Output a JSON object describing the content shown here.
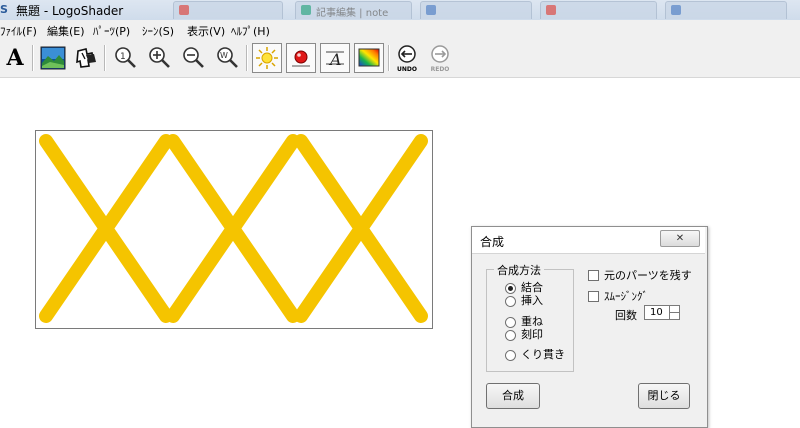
{
  "window": {
    "app_icon_text": "S",
    "title": "無題 - LogoShader",
    "background_tabs": [
      "",
      "記事編集 | note",
      "",
      "",
      ""
    ]
  },
  "menu": [
    "ﾌｧｲﾙ(F)",
    "編集(E)",
    "ﾊﾟｰﾂ(P)",
    "ｼｰﾝ(S)",
    "表示(V)",
    "ﾍﾙﾌﾟ(H)"
  ],
  "toolbar": {
    "text_tool_label": "A",
    "undo_label": "UNDO",
    "redo_label": "REDO",
    "icons": [
      "text-tool-icon",
      "landscape-image-icon",
      "puzzle-parts-icon",
      "zoom-1x-icon",
      "zoom-in-icon",
      "zoom-out-icon",
      "zoom-window-icon",
      "light-source-icon",
      "red-ball-material-icon",
      "edit-shape-icon",
      "rainbow-color-icon",
      "undo-icon",
      "redo-icon"
    ]
  },
  "canvas": {
    "shape_color": "#f5c400",
    "description_shape": "XXX"
  },
  "dialog": {
    "title": "合成",
    "close_label": "✕",
    "method_group_label": "合成方法",
    "methods": [
      "結合",
      "挿入",
      "重ね",
      "刻印",
      "くり貫き"
    ],
    "selected_method": "結合",
    "keep_parts_label": "元のパーツを残す",
    "keep_parts_checked": false,
    "smoothing_label": "ｽﾑｰｼﾞﾝｸﾞ",
    "smoothing_checked": false,
    "count_label": "回数",
    "count_value": "10",
    "combine_button": "合成",
    "close_button": "閉じる"
  }
}
